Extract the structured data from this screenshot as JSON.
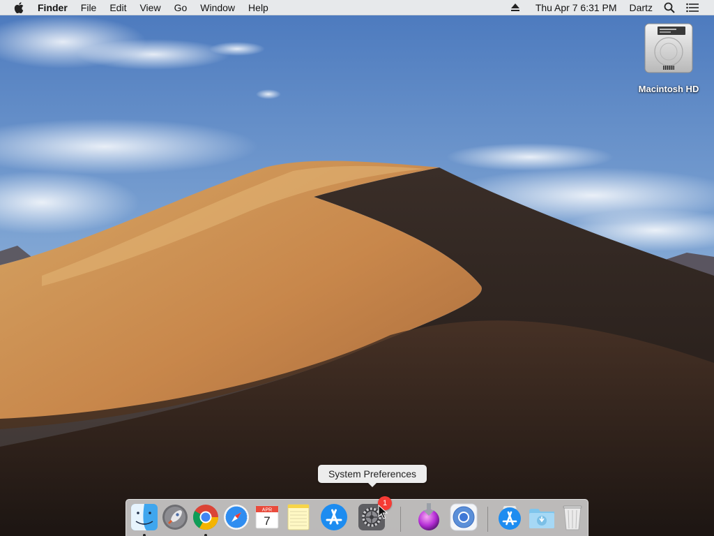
{
  "menubar": {
    "app_name": "Finder",
    "menus": [
      "File",
      "Edit",
      "View",
      "Go",
      "Window",
      "Help"
    ],
    "clock": "Thu Apr 7  6:31 PM",
    "user": "Dartz",
    "icons": [
      "apple-logo",
      "eject-icon",
      "spotlight-search-icon",
      "notification-center-icon"
    ]
  },
  "desktop": {
    "disk_label": "Macintosh HD",
    "wallpaper": "Mojave desert dunes (day)"
  },
  "tooltip": {
    "text": "System Preferences"
  },
  "dock": {
    "items": [
      {
        "name": "Finder",
        "icon": "finder-icon",
        "running": true
      },
      {
        "name": "Launchpad",
        "icon": "launchpad-icon",
        "running": false
      },
      {
        "name": "Google Chrome",
        "icon": "chrome-icon",
        "running": true
      },
      {
        "name": "Safari",
        "icon": "safari-icon",
        "running": false
      },
      {
        "name": "Calendar",
        "icon": "calendar-icon",
        "running": false,
        "month": "APR",
        "day": "7"
      },
      {
        "name": "Notes",
        "icon": "notes-icon",
        "running": false
      },
      {
        "name": "App Store",
        "icon": "app-store-icon",
        "running": false
      },
      {
        "name": "System Preferences",
        "icon": "system-preferences-icon",
        "running": false,
        "badge": "1"
      },
      {
        "name": "Installer",
        "icon": "installer-icon",
        "running": false
      },
      {
        "name": "Chromium",
        "icon": "chromium-icon",
        "running": false
      },
      {
        "name": "Applications",
        "icon": "applications-stack-icon",
        "running": false
      },
      {
        "name": "Downloads",
        "icon": "downloads-folder-icon",
        "running": false
      },
      {
        "name": "Trash",
        "icon": "trash-icon",
        "running": false
      }
    ]
  },
  "colors": {
    "menubar_bg": "#ececec",
    "badge_red": "#f53b35",
    "sky_top": "#4f7fc1",
    "dune_light": "#d9a464",
    "dune_shadow": "#2a211c"
  }
}
